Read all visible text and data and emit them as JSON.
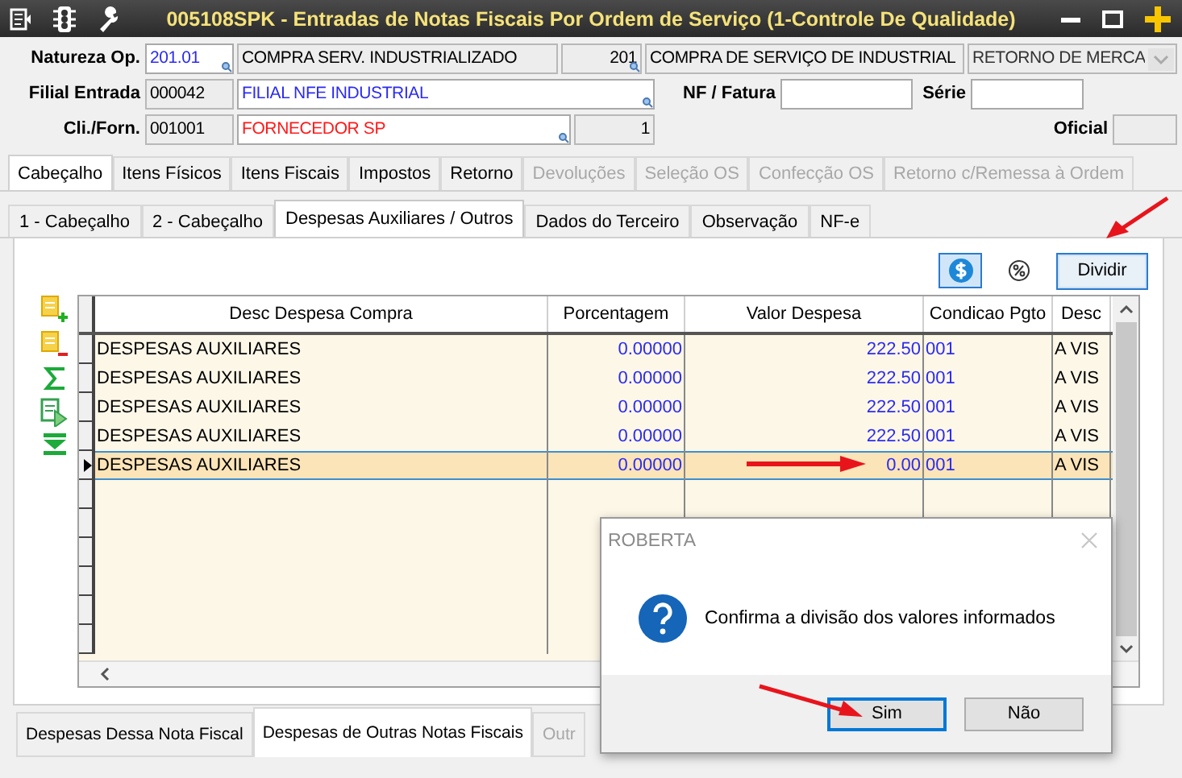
{
  "window": {
    "title": "005108SPK - Entradas de Notas Fiscais Por Ordem de Serviço (1-Controle De Qualidade)"
  },
  "header": {
    "rows": [
      {
        "items": [
          {
            "kind": "label",
            "text": "Natureza Op."
          },
          {
            "kind": "field",
            "value": "201.01",
            "editable": true,
            "color": "#2b2bf0",
            "lookup": true
          },
          {
            "kind": "field",
            "value": "COMPRA SERV. INDUSTRIALIZADO",
            "editable": false,
            "color": "#000000",
            "lookup": false
          },
          {
            "kind": "number",
            "value": "201",
            "editable": false,
            "color": "#000000",
            "lookup": true
          },
          {
            "kind": "field",
            "value": "COMPRA DE SERVIÇO DE INDUSTRIAL",
            "editable": false,
            "color": "#000000",
            "lookup": false
          },
          {
            "kind": "dropdown",
            "value": "RETORNO DE MERCA",
            "disabled": true
          }
        ]
      },
      {
        "items": [
          {
            "kind": "label",
            "text": "Filial Entrada"
          },
          {
            "kind": "field",
            "value": "000042",
            "editable": false,
            "color": "#000000",
            "lookup": false
          },
          {
            "kind": "field",
            "value": "FILIAL NFE INDUSTRIAL",
            "editable": true,
            "color": "#2b2bf0",
            "lookup": true
          },
          {
            "kind": "label",
            "text": "NF / Fatura"
          },
          {
            "kind": "field",
            "editable": true
          },
          {
            "kind": "label",
            "text": "Série"
          },
          {
            "kind": "field",
            "editable": true
          }
        ]
      },
      {
        "items": [
          {
            "kind": "label",
            "text": "Cli./Forn."
          },
          {
            "kind": "field",
            "value": "001001",
            "editable": false,
            "color": "#000000",
            "lookup": false
          },
          {
            "kind": "field",
            "value": "FORNECEDOR SP",
            "editable": true,
            "color": "#ff1a1a",
            "lookup": true
          },
          {
            "kind": "number",
            "value": "1",
            "editable": false,
            "color": "#000000",
            "lookup": false
          },
          {
            "kind": "label",
            "text": "Oficial"
          },
          {
            "kind": "field",
            "editable": false
          }
        ]
      }
    ]
  },
  "tabs": [
    {
      "label": "Cabeçalho",
      "selected": true,
      "disabled": false
    },
    {
      "label": "Itens Físicos",
      "selected": false,
      "disabled": false
    },
    {
      "label": "Itens Fiscais",
      "selected": false,
      "disabled": false
    },
    {
      "label": "Impostos",
      "selected": false,
      "disabled": false
    },
    {
      "label": "Retorno",
      "selected": false,
      "disabled": false
    },
    {
      "label": "Devoluções",
      "selected": false,
      "disabled": true
    },
    {
      "label": "Seleção OS",
      "selected": false,
      "disabled": true
    },
    {
      "label": "Confecção OS",
      "selected": false,
      "disabled": true
    },
    {
      "label": "Retorno c/Remessa à Ordem",
      "selected": false,
      "disabled": true
    }
  ],
  "subtabs": [
    {
      "label": "1 - Cabeçalho",
      "selected": false
    },
    {
      "label": "2 - Cabeçalho",
      "selected": false
    },
    {
      "label": "Despesas Auxiliares / Outros",
      "selected": true
    },
    {
      "label": "Dados do Terceiro",
      "selected": false
    },
    {
      "label": "Observação",
      "selected": false
    },
    {
      "label": "NF-e",
      "selected": false
    }
  ],
  "toolbar": {
    "mode_buttons": [
      {
        "kind": "currency",
        "selected": true
      },
      {
        "kind": "percent",
        "selected": false
      }
    ],
    "divide_button": "Dividir"
  },
  "grid": {
    "columns": [
      "Desc Despesa Compra",
      "Porcentagem",
      "Valor Despesa",
      "Condicao Pgto",
      "Desc"
    ],
    "rows": [
      {
        "cells": [
          "DESPESAS AUXILIARES",
          "0.00000",
          "222.50",
          "001",
          "A VIS"
        ],
        "selected": false
      },
      {
        "cells": [
          "DESPESAS AUXILIARES",
          "0.00000",
          "222.50",
          "001",
          "A VIS"
        ],
        "selected": false
      },
      {
        "cells": [
          "DESPESAS AUXILIARES",
          "0.00000",
          "222.50",
          "001",
          "A VIS"
        ],
        "selected": false
      },
      {
        "cells": [
          "DESPESAS AUXILIARES",
          "0.00000",
          "222.50",
          "001",
          "A VIS"
        ],
        "selected": false
      },
      {
        "cells": [
          "DESPESAS AUXILIARES",
          "0.00000",
          "0.00",
          "001",
          "A VIS"
        ],
        "selected": true
      }
    ]
  },
  "bottom_tabs": [
    {
      "label": "Despesas Dessa Nota Fiscal",
      "selected": false,
      "disabled": false
    },
    {
      "label": "Despesas de Outras Notas Fiscais",
      "selected": true,
      "disabled": false
    },
    {
      "label": "Outr",
      "selected": false,
      "disabled": true
    }
  ],
  "dialog": {
    "title": "ROBERTA",
    "message": "Confirma a divisão dos valores informados",
    "buttons": [
      {
        "label": "Sim",
        "focused": true
      },
      {
        "label": "Não",
        "focused": false
      }
    ]
  }
}
